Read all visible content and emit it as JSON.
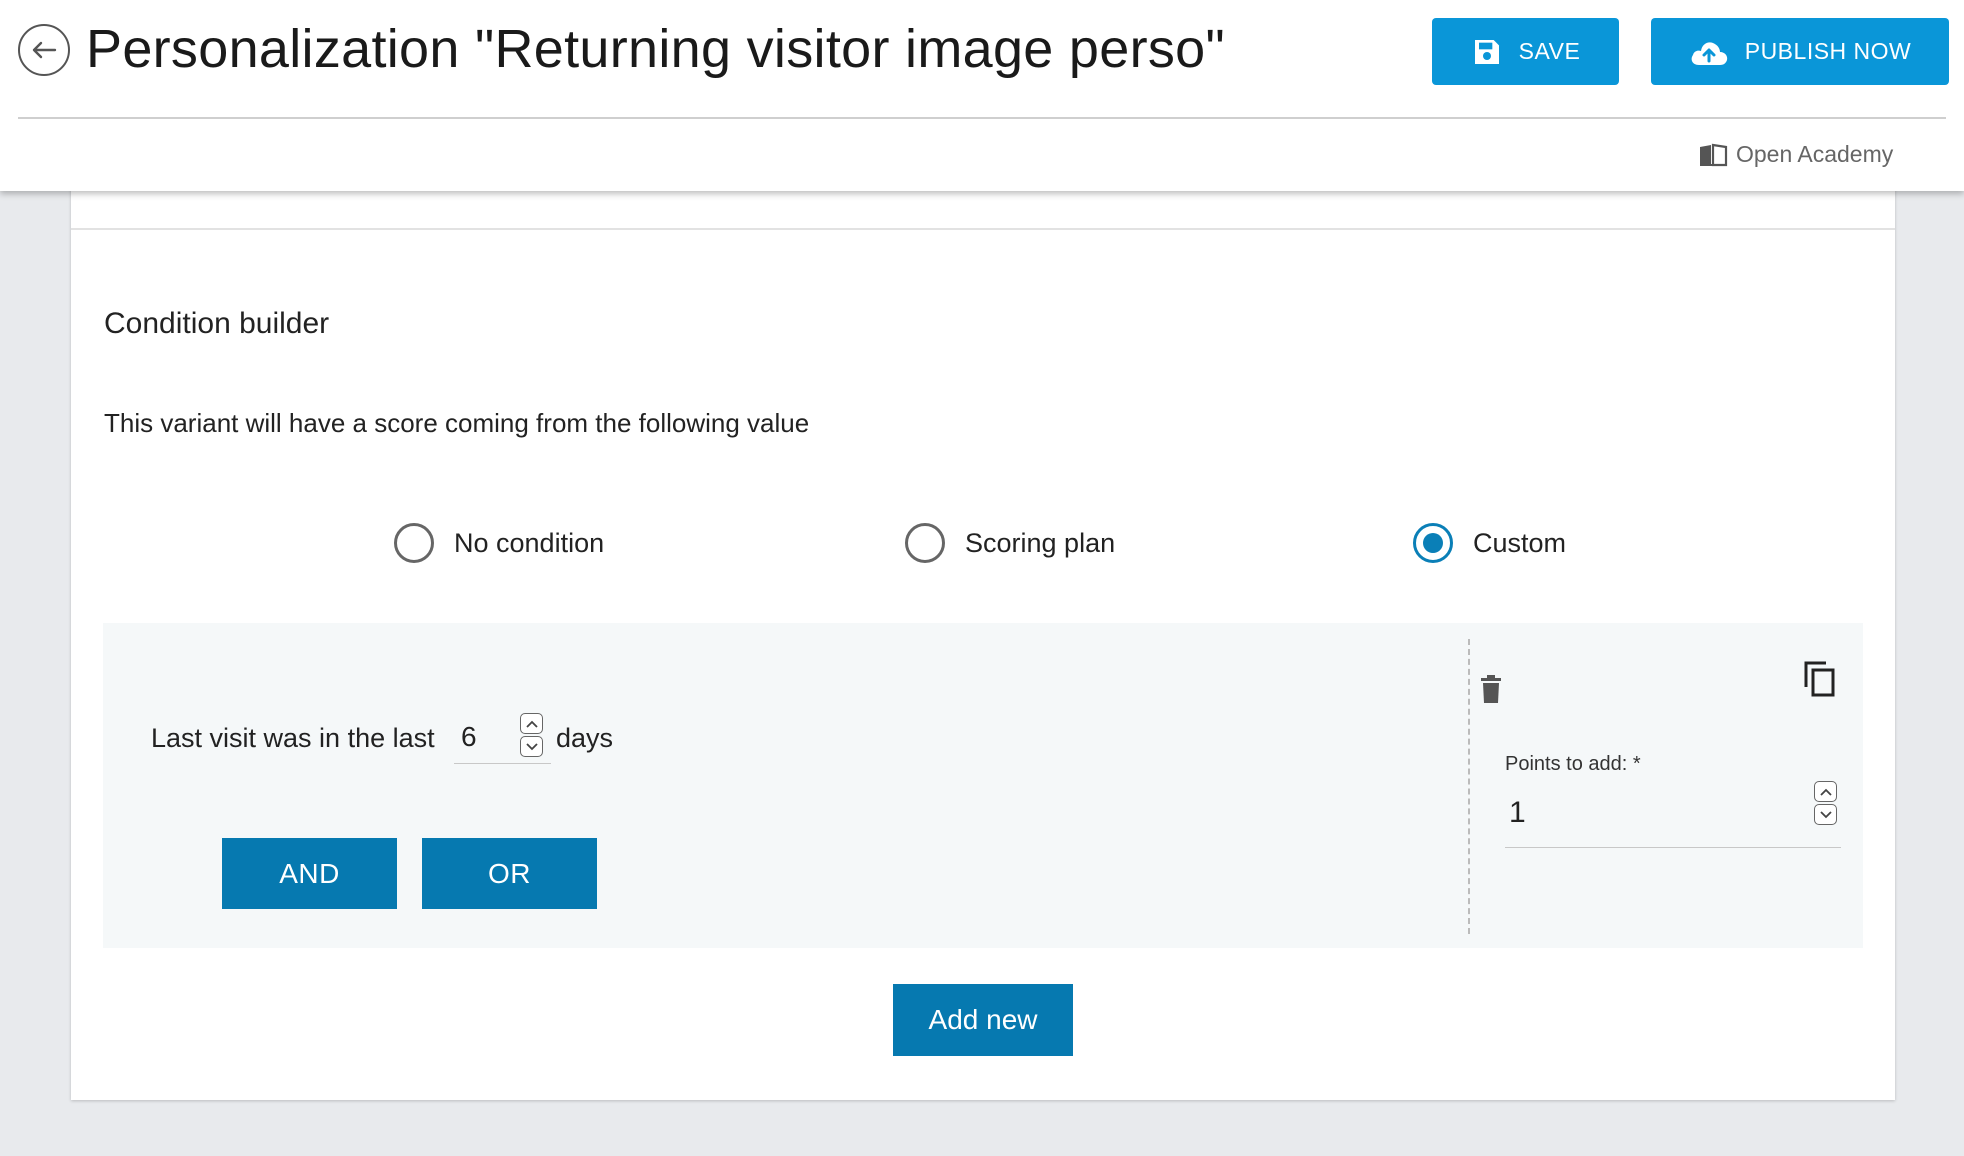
{
  "header": {
    "title": "Personalization \"Returning visitor image perso\"",
    "save_label": "SAVE",
    "publish_label": "PUBLISH NOW",
    "academy_label": "Open Academy"
  },
  "condition_builder": {
    "title": "Condition builder",
    "description": "This variant will have a score coming from the following value",
    "options": [
      {
        "label": "No condition",
        "selected": false
      },
      {
        "label": "Scoring plan",
        "selected": false
      },
      {
        "label": "Custom",
        "selected": true
      }
    ],
    "rule": {
      "prefix": "Last visit was in the last",
      "value": "6",
      "suffix": "days"
    },
    "and_label": "AND",
    "or_label": "OR",
    "points_label": "Points to add: *",
    "points_value": "1",
    "add_new_label": "Add new"
  },
  "colors": {
    "primary_button": "#0a96d8",
    "action_button": "#0679b0",
    "radio_selected": "#0a7fb7"
  },
  "icons": {
    "back": "arrow-left-icon",
    "save": "floppy-disk-icon",
    "publish": "cloud-upload-icon",
    "academy": "open-book-icon",
    "delete": "trash-icon",
    "duplicate": "copy-icon"
  }
}
